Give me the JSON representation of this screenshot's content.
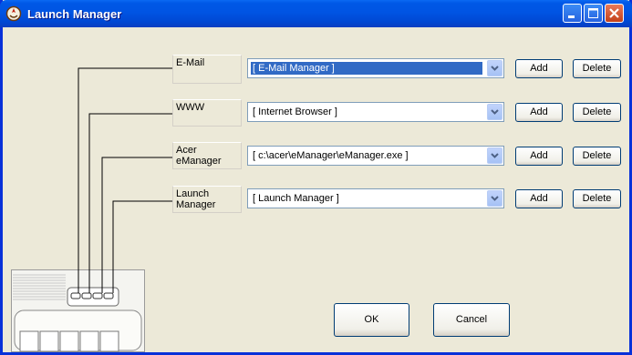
{
  "window": {
    "title": "Launch Manager"
  },
  "rows": [
    {
      "label": "E-Mail",
      "value": "[ E-Mail Manager ]",
      "selected": true
    },
    {
      "label": "WWW",
      "value": "[ Internet Browser ]",
      "selected": false
    },
    {
      "label": "Acer eManager",
      "value": "[ c:\\acer\\eManager\\eManager.exe ]",
      "selected": false
    },
    {
      "label": "Launch Manager",
      "value": "[ Launch Manager ]",
      "selected": false
    }
  ],
  "buttons": {
    "add": "Add",
    "delete": "Delete",
    "ok": "OK",
    "cancel": "Cancel"
  },
  "colors": {
    "titlebar": "#0054e3",
    "selection": "#316ac5",
    "close": "#c3401a"
  },
  "icons": {
    "app": "launch-manager-icon",
    "minimize": "minimize-icon",
    "maximize": "maximize-icon",
    "close": "close-icon",
    "dropdown": "chevron-down-icon"
  }
}
